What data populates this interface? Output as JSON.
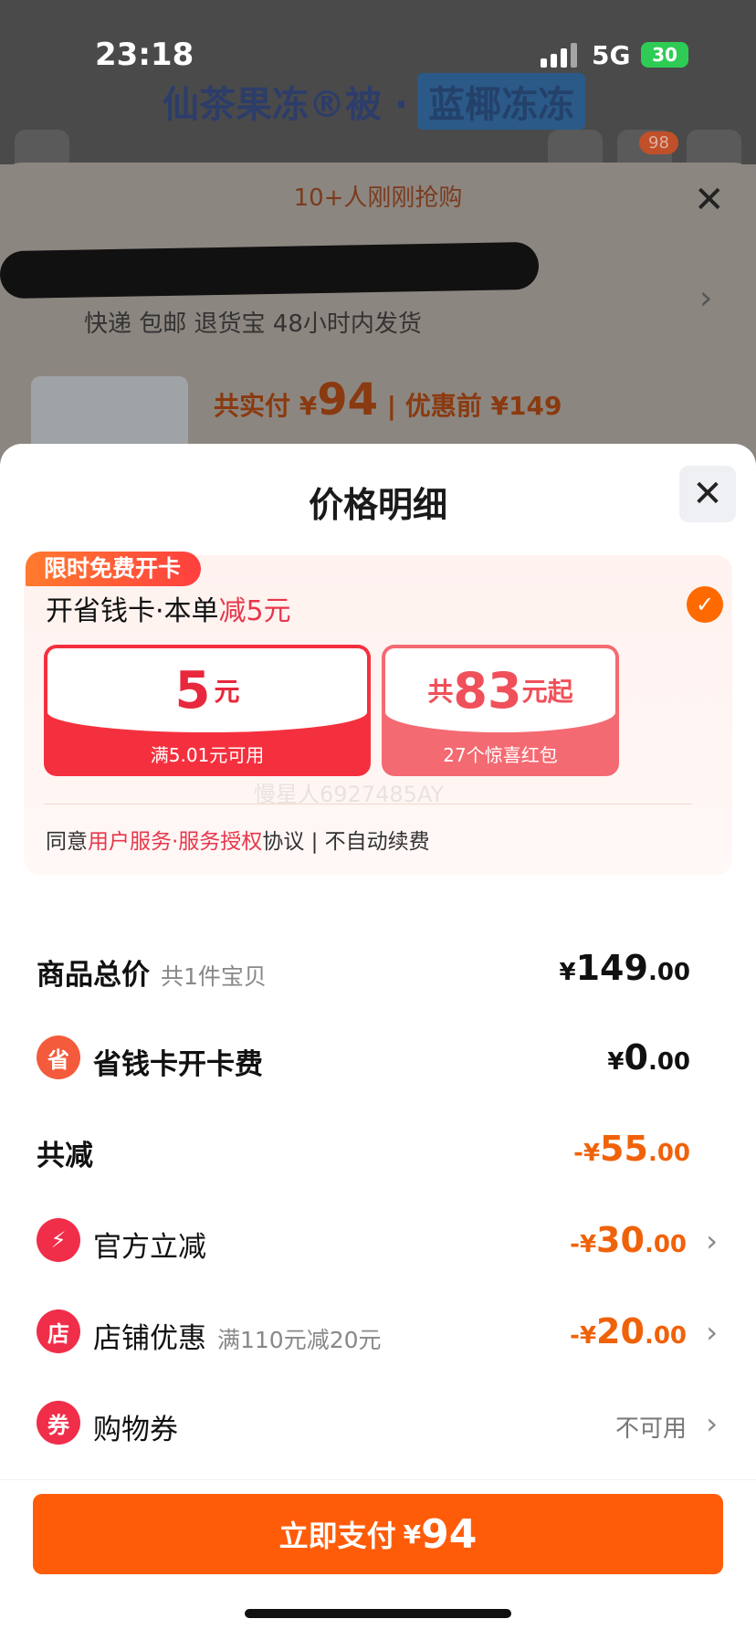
{
  "status_bar": {
    "time": "23:18",
    "network": "5G",
    "battery": "30"
  },
  "background": {
    "product_title": "仙茶果冻®被 ·",
    "product_tag": "蓝椰冻冻",
    "cart_badge": "98",
    "buyers_notice": "10+人刚刚抢购",
    "shipping_info": "快递 包邮 退货宝 48小时内发货",
    "pay_prefix": "共实付 ¥",
    "pay_amount": "94",
    "pay_original": "| 优惠前 ¥149"
  },
  "sheet": {
    "title": "价格明细",
    "card": {
      "badge": "限时免费开卡",
      "title_prefix": "开省钱卡·本单",
      "title_highlight": "减5元",
      "coupon_a_amount": "5",
      "coupon_a_unit": "元",
      "coupon_a_desc": "满5.01元可用",
      "coupon_b_prefix": "共",
      "coupon_b_amount": "83",
      "coupon_b_unit": "元起",
      "coupon_b_desc": "27个惊喜红包",
      "watermark": "慢星人6927485AY",
      "agree_prefix": "同意",
      "agree_link": "用户服务·服务授权",
      "agree_suffix": "协议 | 不自动续费"
    },
    "rows": [
      {
        "label": "商品总价",
        "sub": "共1件宝贝",
        "cur": "¥",
        "int": "149",
        "dec": ".00"
      },
      {
        "label": "省钱卡开卡费",
        "cur": "¥",
        "int": "0",
        "dec": ".00"
      },
      {
        "label": "共减",
        "cur": "-¥",
        "int": "55",
        "dec": ".00"
      },
      {
        "label": "官方立减",
        "cur": "-¥",
        "int": "30",
        "dec": ".00"
      },
      {
        "label": "店铺优惠",
        "sub": "满110元减20元",
        "cur": "-¥",
        "int": "20",
        "dec": ".00"
      },
      {
        "label": "购物券",
        "value_text": "不可用"
      }
    ],
    "pay_button": {
      "label": "立即支付",
      "cur": "¥",
      "amount": "94"
    }
  },
  "colors": {
    "accent": "#ff5c0a",
    "red": "#e8364b",
    "discount": "#f0620a"
  }
}
